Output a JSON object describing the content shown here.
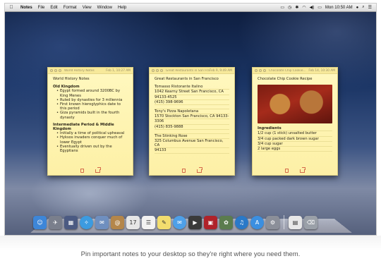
{
  "menubar": {
    "apple_icon": "apple-icon",
    "app_name": "Notes",
    "menus": [
      "File",
      "Edit",
      "Format",
      "View",
      "Window",
      "Help"
    ],
    "clock": "Mon 10:50 AM"
  },
  "notes": [
    {
      "title": "World History Notes",
      "date": "Feb 1, 10:27 AM",
      "heading": "World History Notes",
      "sections": [
        {
          "title": "Old Kingdom",
          "items": [
            "Egypt formed around 3200BC by King Menes",
            "Ruled by dynasties for 3 millennia",
            "First known hieroglyphics date to this period",
            "Giza pyramids built in the fourth dynasty"
          ]
        },
        {
          "title": "Intermediate Period & Middle Kingdom",
          "items": [
            "Initially a time of political upheaval",
            "Hyksos invaders conquer much of lower Egypt",
            "Eventually driven out by the Egyptians"
          ]
        }
      ]
    },
    {
      "title": "Great Restaurants in San Fra...",
      "date": "Feb 9, 9:49 AM",
      "heading": "Great Restaurants in San Francisco",
      "lines": [
        "Tomasso Ristorante Italino",
        "1042 Kearny Street San Francisco, CA",
        "94133-4525",
        "(415) 398-9696",
        "",
        "Tony's Pizza Napoletana",
        "1570 Stockton San Francisco, CA 94133-",
        "3306",
        "(415) 835-9888",
        "",
        "The Stinking Rose",
        "325 Columbus Avenue San Francisco, CA",
        "94133"
      ]
    },
    {
      "title": "Chocolate Chip Cookie...",
      "date": "Feb 14, 10:30 AM",
      "heading": "Chocolate Chip Cookie Recipe",
      "image": "chocolate-chip-cookies-photo",
      "lines": [
        "Ingredients",
        "1/2 cup (1 stick) unsalted butter",
        "3/4 cup packed dark brown sugar",
        "3/4 cup sugar",
        "2 large eggs"
      ]
    }
  ],
  "dock": {
    "icons": [
      {
        "name": "finder-icon",
        "color": "#3d86d8",
        "glyph": "☺"
      },
      {
        "name": "launchpad-icon",
        "color": "#7a7f8c",
        "glyph": "✈"
      },
      {
        "name": "mission-control-icon",
        "color": "#4b5a82",
        "glyph": "▦"
      },
      {
        "name": "safari-icon",
        "color": "#3c9be0",
        "glyph": "✧"
      },
      {
        "name": "mail-icon",
        "color": "#6f8fbf",
        "glyph": "✉"
      },
      {
        "name": "contacts-icon",
        "color": "#b4864a",
        "glyph": "@"
      },
      {
        "name": "calendar-icon",
        "color": "#e6e6e6",
        "glyph": "17"
      },
      {
        "name": "reminders-icon",
        "color": "#f2f2f2",
        "glyph": "☰"
      },
      {
        "name": "notes-icon",
        "color": "#f2dd6e",
        "glyph": "✎"
      },
      {
        "name": "messages-icon",
        "color": "#4ea0e8",
        "glyph": "✉"
      },
      {
        "name": "facetime-icon",
        "color": "#3a3a3a",
        "glyph": "▶"
      },
      {
        "name": "photo-booth-icon",
        "color": "#b0222a",
        "glyph": "▣"
      },
      {
        "name": "iphoto-icon",
        "color": "#5b7c4e",
        "glyph": "✿"
      },
      {
        "name": "itunes-icon",
        "color": "#2a79c8",
        "glyph": "♫"
      },
      {
        "name": "app-store-icon",
        "color": "#3b8fe0",
        "glyph": "A"
      },
      {
        "name": "system-preferences-icon",
        "color": "#8b8f99",
        "glyph": "⚙"
      },
      {
        "name": "document-icon",
        "color": "#e8e8e8",
        "glyph": "▤"
      },
      {
        "name": "trash-icon",
        "color": "#9aa0a8",
        "glyph": "⌫"
      }
    ]
  },
  "caption": "Pin important notes to your desktop so they're right where you need them."
}
